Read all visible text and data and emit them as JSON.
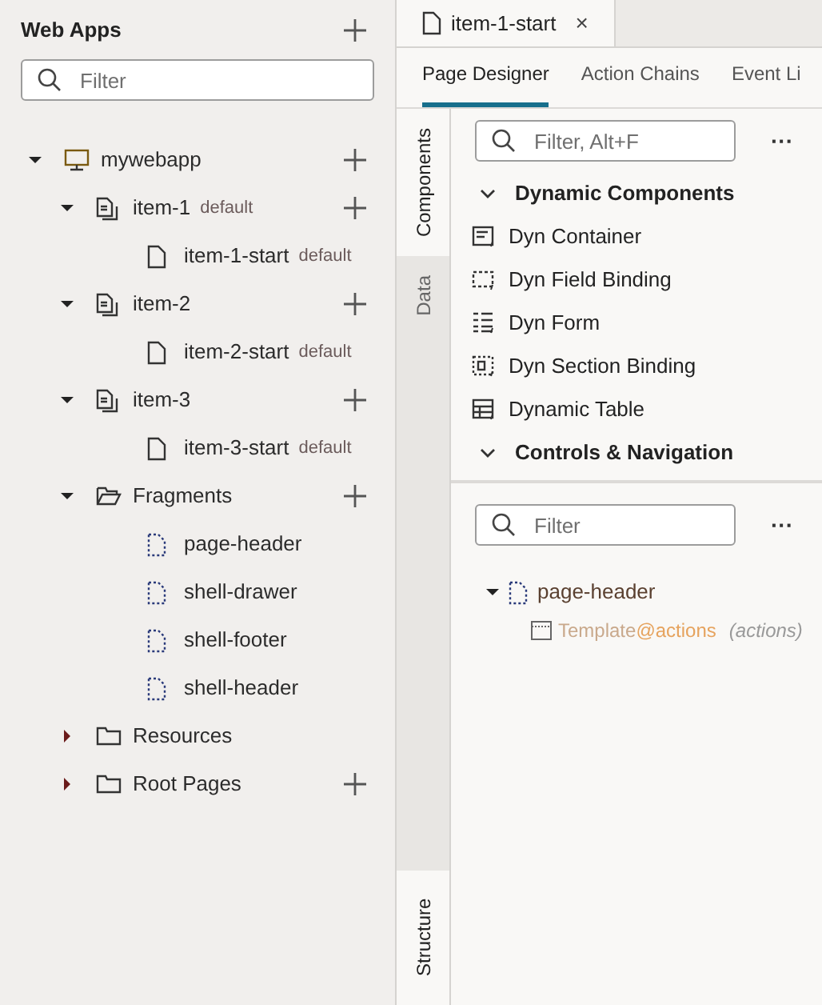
{
  "sidebar": {
    "title": "Web Apps",
    "filter": {
      "placeholder": "Filter"
    },
    "tree": [
      {
        "label": "mywebapp",
        "kind": "app",
        "add": true,
        "expanded": true,
        "children": [
          {
            "label": "item-1",
            "badge": "default",
            "kind": "flow",
            "add": true,
            "expanded": true,
            "children": [
              {
                "label": "item-1-start",
                "badge": "default",
                "kind": "page"
              }
            ]
          },
          {
            "label": "item-2",
            "kind": "flow",
            "add": true,
            "expanded": true,
            "children": [
              {
                "label": "item-2-start",
                "badge": "default",
                "kind": "page"
              }
            ]
          },
          {
            "label": "item-3",
            "kind": "flow",
            "add": true,
            "expanded": true,
            "children": [
              {
                "label": "item-3-start",
                "badge": "default",
                "kind": "page"
              }
            ]
          },
          {
            "label": "Fragments",
            "kind": "openfolder",
            "add": true,
            "expanded": true,
            "children": [
              {
                "label": "page-header",
                "kind": "fragment"
              },
              {
                "label": "shell-drawer",
                "kind": "fragment"
              },
              {
                "label": "shell-footer",
                "kind": "fragment"
              },
              {
                "label": "shell-header",
                "kind": "fragment"
              }
            ]
          },
          {
            "label": "Resources",
            "kind": "folder",
            "add": false,
            "expanded": false
          },
          {
            "label": "Root Pages",
            "kind": "folder",
            "add": true,
            "expanded": false
          }
        ]
      }
    ]
  },
  "editor_tab": {
    "label": "item-1-start",
    "close": "×"
  },
  "designer_tabs": [
    {
      "label": "Page Designer",
      "selected": true
    },
    {
      "label": "Action Chains",
      "selected": false
    },
    {
      "label": "Event Li",
      "selected": false
    }
  ],
  "side_tabs": [
    {
      "label": "Components",
      "selected": true
    },
    {
      "label": "Data",
      "selected": false
    }
  ],
  "components": {
    "filter": {
      "placeholder": "Filter, Alt+F"
    },
    "more": "···",
    "sections": [
      {
        "title": "Dynamic Components",
        "expanded": true,
        "items": [
          {
            "label": "Dyn Container",
            "kind": "container"
          },
          {
            "label": "Dyn Field Binding",
            "kind": "field"
          },
          {
            "label": "Dyn Form",
            "kind": "form"
          },
          {
            "label": "Dyn Section Binding",
            "kind": "section"
          },
          {
            "label": "Dynamic Table",
            "kind": "table"
          }
        ]
      },
      {
        "title": "Controls & Navigation",
        "expanded": true
      }
    ]
  },
  "structure": {
    "tab": {
      "label": "Structure",
      "selected": true
    },
    "filter": {
      "placeholder": "Filter"
    },
    "more": "···",
    "tree": [
      {
        "label": "page-header",
        "expanded": true,
        "children": [
          {
            "name": "Template",
            "binding": "@actions",
            "note": "(actions)"
          }
        ]
      }
    ]
  }
}
